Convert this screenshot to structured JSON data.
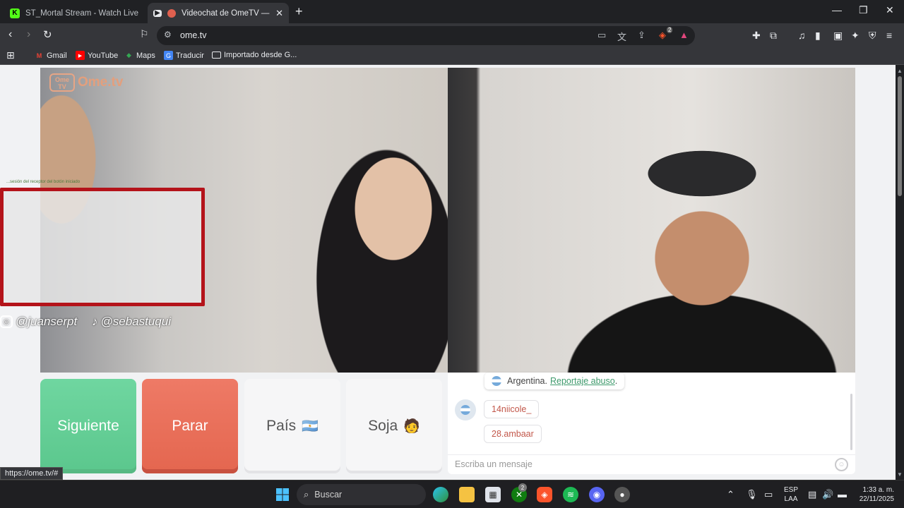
{
  "browser": {
    "tabs": [
      {
        "title": "ST_Mortal Stream - Watch Live on Ki",
        "active": false
      },
      {
        "title": "Videochat de OmeTV — Alter",
        "active": true
      }
    ],
    "new_tab_label": "+",
    "url": "ome.tv",
    "bookmarks": [
      {
        "label": "Gmail"
      },
      {
        "label": "YouTube"
      },
      {
        "label": "Maps"
      },
      {
        "label": "Traducir"
      },
      {
        "label": "Importado desde G..."
      }
    ],
    "brave_badge": "2",
    "status_url": "https://ome.tv/#"
  },
  "page": {
    "logo_text": "Ome.tv",
    "logo_box_text": "Ome TV",
    "overlay_caption": "...sesión del receptor del botón iniciado",
    "social": [
      {
        "handle": "@juanserpt",
        "icon": "instagram-icon"
      },
      {
        "handle": "@sebastuqui",
        "icon": "tiktok-icon"
      }
    ],
    "buttons": {
      "next": "Siguiente",
      "stop": "Parar",
      "country": "País",
      "country_emoji": "🇦🇷",
      "gender": "Soja",
      "gender_emoji": "🧑"
    },
    "chat": {
      "notice_country": "Argentina.",
      "notice_link": "Reportaje abuso",
      "notice_end": ".",
      "messages": [
        "14niicole_",
        "28.ambaar"
      ],
      "input_placeholder": "Escriba un mensaje"
    }
  },
  "taskbar": {
    "search_placeholder": "Buscar",
    "xbox_badge": "2",
    "language": "ESP",
    "layout": "LAA",
    "time": "1:33 a. m.",
    "date": "22/11/2025"
  },
  "colors": {
    "next_button": "#5bc78d",
    "stop_button": "#e4664f",
    "report_link": "#3e9a6c",
    "chat_username": "#c2574a"
  }
}
